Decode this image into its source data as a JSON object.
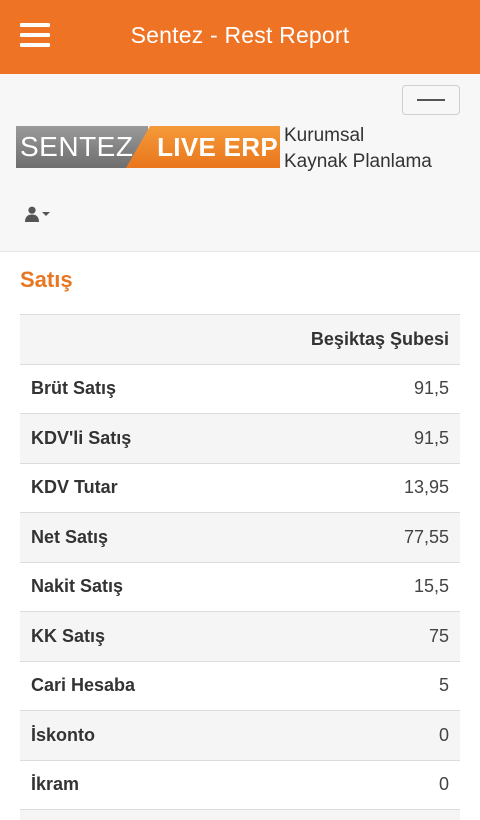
{
  "appbar": {
    "title": "Sentez - Rest Report"
  },
  "logo": {
    "brand_left": "SENTEZ",
    "brand_right": "LIVE ERP",
    "subtitle_line1": "Kurumsal",
    "subtitle_line2": "Kaynak Planlama"
  },
  "icons": {
    "menu": "hamburger-icon",
    "user": "user-icon",
    "caret": "caret-down-icon"
  },
  "colors": {
    "accent": "#ee7325",
    "section_title": "#e87722"
  },
  "section": {
    "title": "Satış"
  },
  "table": {
    "column_header": "Beşiktaş Şubesi",
    "rows": [
      {
        "label": "Brüt Satış",
        "value": "91,5"
      },
      {
        "label": "KDV'li Satış",
        "value": "91,5"
      },
      {
        "label": "KDV Tutar",
        "value": "13,95"
      },
      {
        "label": "Net Satış",
        "value": "77,55"
      },
      {
        "label": "Nakit Satış",
        "value": "15,5"
      },
      {
        "label": "KK Satış",
        "value": "75"
      },
      {
        "label": "Cari Hesaba",
        "value": "5"
      },
      {
        "label": "İskonto",
        "value": "0"
      },
      {
        "label": "İkram",
        "value": "0"
      }
    ]
  }
}
